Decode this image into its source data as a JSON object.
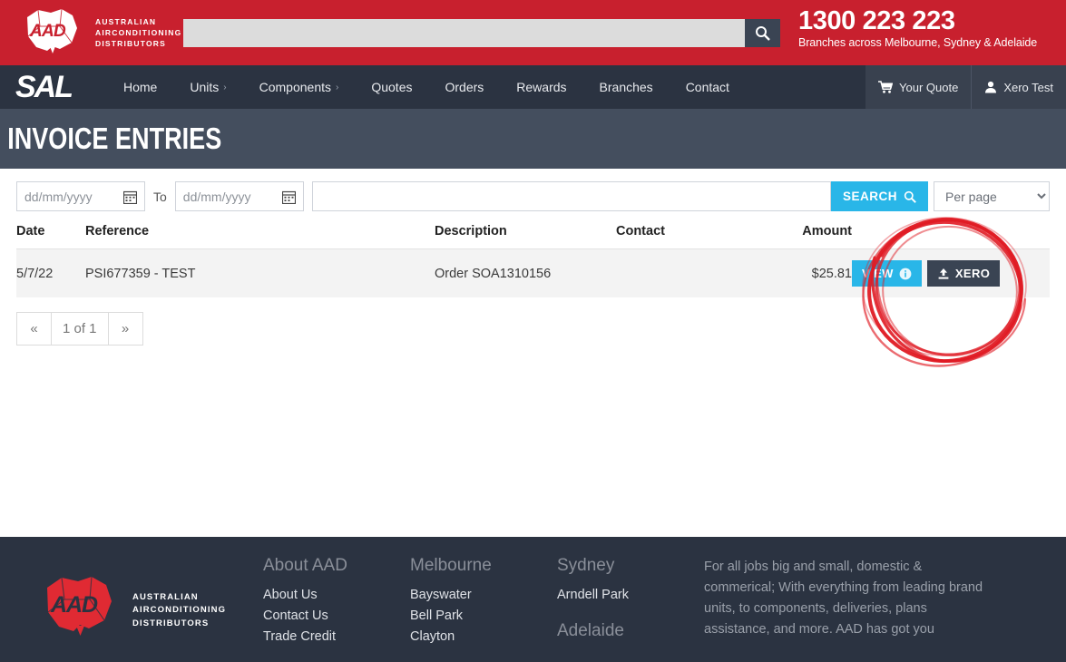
{
  "header": {
    "brand_line1": "AUSTRALIAN",
    "brand_line2": "AIRCONDITIONING",
    "brand_line3": "DISTRIBUTORS",
    "search_placeholder": "",
    "search_value": "",
    "search_icon": "search-icon",
    "phone": "1300 223 223",
    "phone_sub": "Branches across Melbourne, Sydney & Adelaide",
    "red": "#c8202e"
  },
  "nav": {
    "logo": "SAL",
    "items": [
      {
        "label": "Home",
        "caret": ""
      },
      {
        "label": "Units",
        "caret": "›"
      },
      {
        "label": "Components",
        "caret": "›"
      },
      {
        "label": "Quotes",
        "caret": ""
      },
      {
        "label": "Orders",
        "caret": ""
      },
      {
        "label": "Rewards",
        "caret": ""
      },
      {
        "label": "Branches",
        "caret": ""
      },
      {
        "label": "Contact",
        "caret": ""
      }
    ],
    "quote_label": "Your Quote",
    "quote_icon": "cart-icon",
    "user_label": "Xero Test",
    "user_icon": "user-icon"
  },
  "page": {
    "title": "INVOICE ENTRIES"
  },
  "filters": {
    "date_from_placeholder": "dd/mm/yyyy",
    "date_from_value": "",
    "date_to_placeholder": "dd/mm/yyyy",
    "date_to_value": "",
    "to_label": "To",
    "calendar_icon": "calendar-icon",
    "keyword_placeholder": "",
    "keyword_value": "",
    "search_label": "SEARCH",
    "search_icon": "search-icon",
    "per_page_label": "Per page",
    "per_page_options": [
      "Per page"
    ],
    "accent": "#29b6e8"
  },
  "table": {
    "columns": [
      "Date",
      "Reference",
      "Description",
      "Contact",
      "Amount"
    ],
    "rows": [
      {
        "date": "5/7/22",
        "reference": "PSI677359 - TEST",
        "description": "Order SOA1310156",
        "contact": "",
        "amount": "$25.81",
        "view_label": "VIEW",
        "view_icon": "info-circle-icon",
        "xero_label": "XERO",
        "xero_icon": "upload-icon"
      }
    ]
  },
  "pagination": {
    "first_icon": "«",
    "page_label": "1 of 1",
    "last_icon": "»"
  },
  "footer": {
    "brand_line1": "AUSTRALIAN",
    "brand_line2": "AIRCONDITIONING",
    "brand_line3": "DISTRIBUTORS",
    "columns": [
      {
        "heading": "About AAD",
        "links": [
          "About Us",
          "Contact Us",
          "Trade Credit"
        ]
      },
      {
        "heading": "Melbourne",
        "links": [
          "Bayswater",
          "Bell Park",
          "Clayton"
        ]
      },
      {
        "heading": "Sydney",
        "links": [
          "Arndell Park"
        ],
        "heading2": "Adelaide"
      }
    ],
    "blurb": "For all jobs big and small, domestic & commerical; With everything from leading brand units, to components, deliveries, plans assistance, and more. AAD has got you"
  },
  "annotation": {
    "type": "hand-drawn-red-circle",
    "color": "#e01b24"
  }
}
